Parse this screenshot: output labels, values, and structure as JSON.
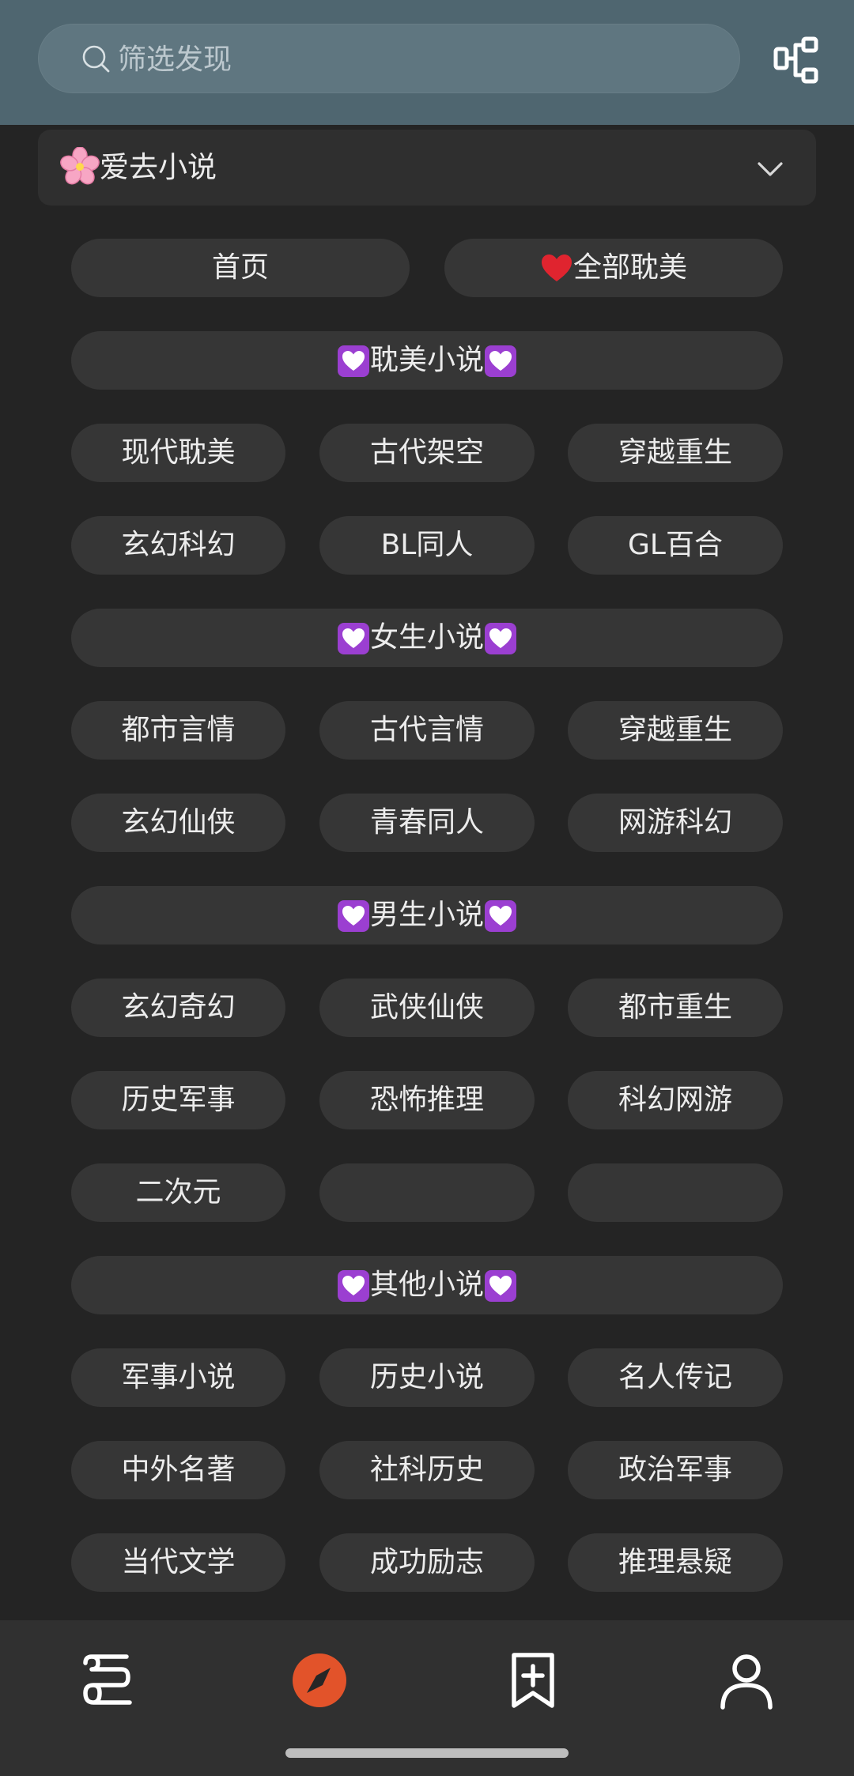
{
  "search": {
    "placeholder": "筛选发现"
  },
  "source": {
    "label": "爱去小说",
    "icon": "cherry-blossom-icon"
  },
  "top_links": [
    "首页",
    "全部耽美"
  ],
  "sections": [
    {
      "title": "耽美小说",
      "items": [
        "现代耽美",
        "古代架空",
        "穿越重生",
        "玄幻科幻",
        "BL同人",
        "GL百合"
      ]
    },
    {
      "title": "女生小说",
      "items": [
        "都市言情",
        "古代言情",
        "穿越重生",
        "玄幻仙侠",
        "青春同人",
        "网游科幻"
      ]
    },
    {
      "title": "男生小说",
      "items": [
        "玄幻奇幻",
        "武侠仙侠",
        "都市重生",
        "历史军事",
        "恐怖推理",
        "科幻网游",
        "二次元",
        "",
        ""
      ]
    },
    {
      "title": "其他小说",
      "items": [
        "军事小说",
        "历史小说",
        "名人传记",
        "中外名著",
        "社科历史",
        "政治军事",
        "当代文学",
        "成功励志",
        "推理悬疑"
      ]
    }
  ],
  "tabs": [
    {
      "name": "bookshelf",
      "icon": "bookshelf-icon",
      "active": false
    },
    {
      "name": "discover",
      "icon": "compass-icon",
      "active": true
    },
    {
      "name": "subscribe",
      "icon": "bookmark-add-icon",
      "active": false
    },
    {
      "name": "profile",
      "icon": "user-icon",
      "active": false
    }
  ],
  "colors": {
    "header_bg": "#4f6670",
    "page_bg": "#242424",
    "pill_bg": "#363636",
    "accent": "#e2532a",
    "heart_purple": "#9b3fd1",
    "heart_red": "#e0242f"
  }
}
